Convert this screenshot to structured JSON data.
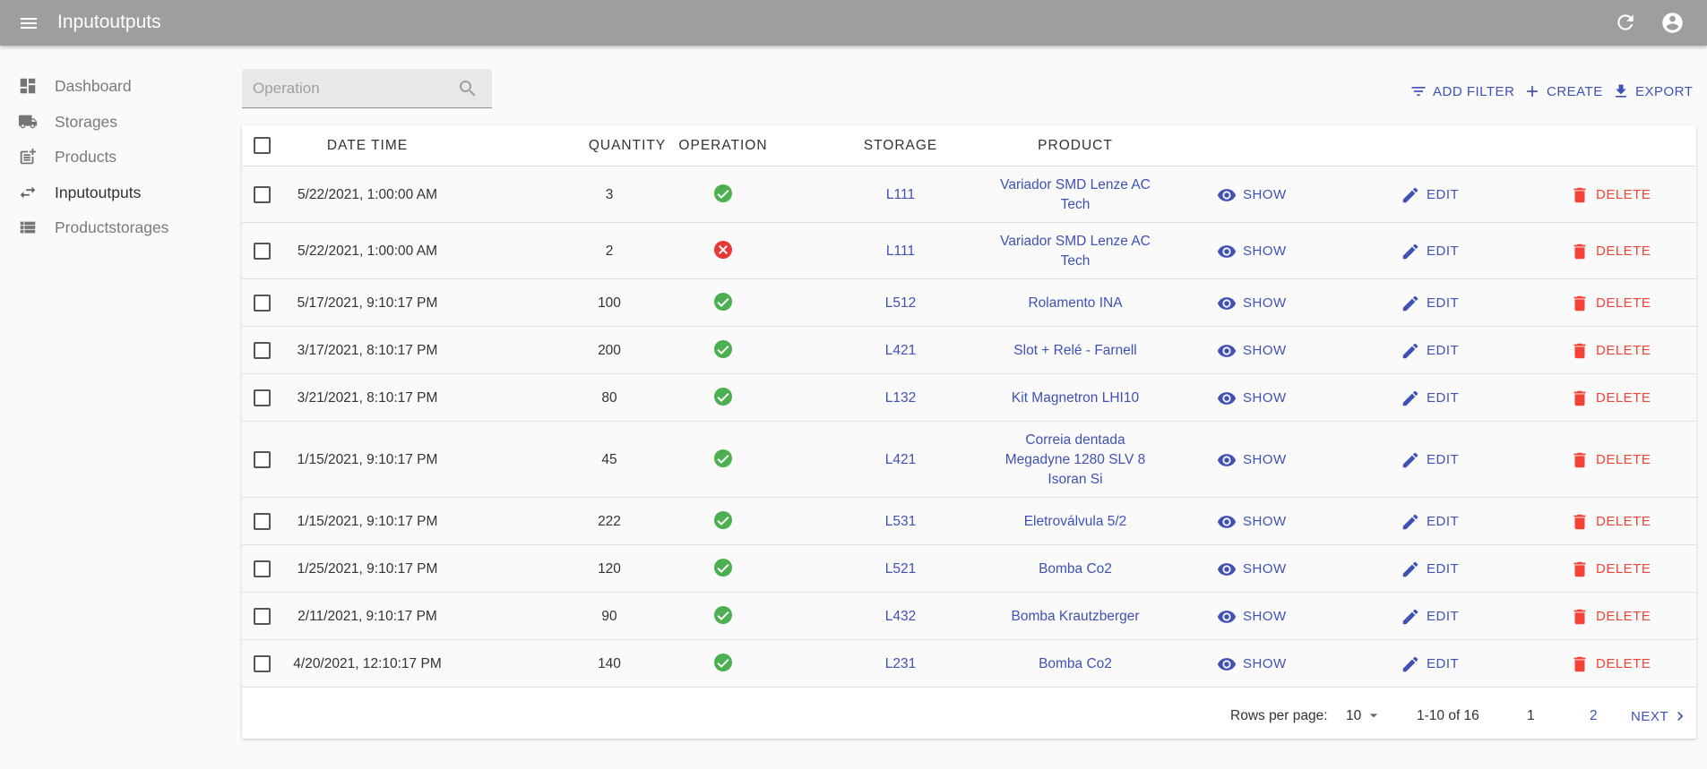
{
  "appbar": {
    "title": "Inputoutputs"
  },
  "sidebar": {
    "items": [
      {
        "label": "Dashboard",
        "icon": "dashboard-icon",
        "active": false
      },
      {
        "label": "Storages",
        "icon": "truck-icon",
        "active": false
      },
      {
        "label": "Products",
        "icon": "post-add-icon",
        "active": false
      },
      {
        "label": "Inputoutputs",
        "icon": "swap-horiz-icon",
        "active": true
      },
      {
        "label": "Productstorages",
        "icon": "view-list-icon",
        "active": false
      }
    ]
  },
  "search": {
    "placeholder": "Operation"
  },
  "toolbar": {
    "add_filter": "ADD FILTER",
    "create": "CREATE",
    "export": "EXPORT"
  },
  "table": {
    "headers": {
      "datetime": "DATE TIME",
      "quantity": "QUANTITY",
      "operation": "OPERATION",
      "storage": "STORAGE",
      "product": "PRODUCT"
    },
    "actions": {
      "show": "SHOW",
      "edit": "EDIT",
      "delete": "DELETE"
    },
    "rows": [
      {
        "datetime": "5/22/2021, 1:00:00 AM",
        "quantity": "3",
        "operation": true,
        "storage": "L111",
        "product": "Variador SMD Lenze AC Tech"
      },
      {
        "datetime": "5/22/2021, 1:00:00 AM",
        "quantity": "2",
        "operation": false,
        "storage": "L111",
        "product": "Variador SMD Lenze AC Tech"
      },
      {
        "datetime": "5/17/2021, 9:10:17 PM",
        "quantity": "100",
        "operation": true,
        "storage": "L512",
        "product": "Rolamento INA"
      },
      {
        "datetime": "3/17/2021, 8:10:17 PM",
        "quantity": "200",
        "operation": true,
        "storage": "L421",
        "product": "Slot + Relé - Farnell"
      },
      {
        "datetime": "3/21/2021, 8:10:17 PM",
        "quantity": "80",
        "operation": true,
        "storage": "L132",
        "product": "Kit Magnetron LHI10"
      },
      {
        "datetime": "1/15/2021, 9:10:17 PM",
        "quantity": "45",
        "operation": true,
        "storage": "L421",
        "product": "Correia dentada Megadyne 1280 SLV 8 Isoran Si"
      },
      {
        "datetime": "1/15/2021, 9:10:17 PM",
        "quantity": "222",
        "operation": true,
        "storage": "L531",
        "product": "Eletroválvula 5/2"
      },
      {
        "datetime": "1/25/2021, 9:10:17 PM",
        "quantity": "120",
        "operation": true,
        "storage": "L521",
        "product": "Bomba Co2"
      },
      {
        "datetime": "2/11/2021, 9:10:17 PM",
        "quantity": "90",
        "operation": true,
        "storage": "L432",
        "product": "Bomba Krautzberger"
      },
      {
        "datetime": "4/20/2021, 12:10:17 PM",
        "quantity": "140",
        "operation": true,
        "storage": "L231",
        "product": "Bomba Co2"
      }
    ]
  },
  "pagination": {
    "rows_per_page_label": "Rows per page:",
    "rows_per_page": "10",
    "range": "1-10 of 16",
    "pages": [
      "1",
      "2"
    ],
    "next": "NEXT"
  },
  "colors": {
    "appbar": "#9e9e9e",
    "primary": "#3f51b5",
    "danger": "#f44336",
    "success": "#4caf50",
    "error": "#e53935"
  }
}
